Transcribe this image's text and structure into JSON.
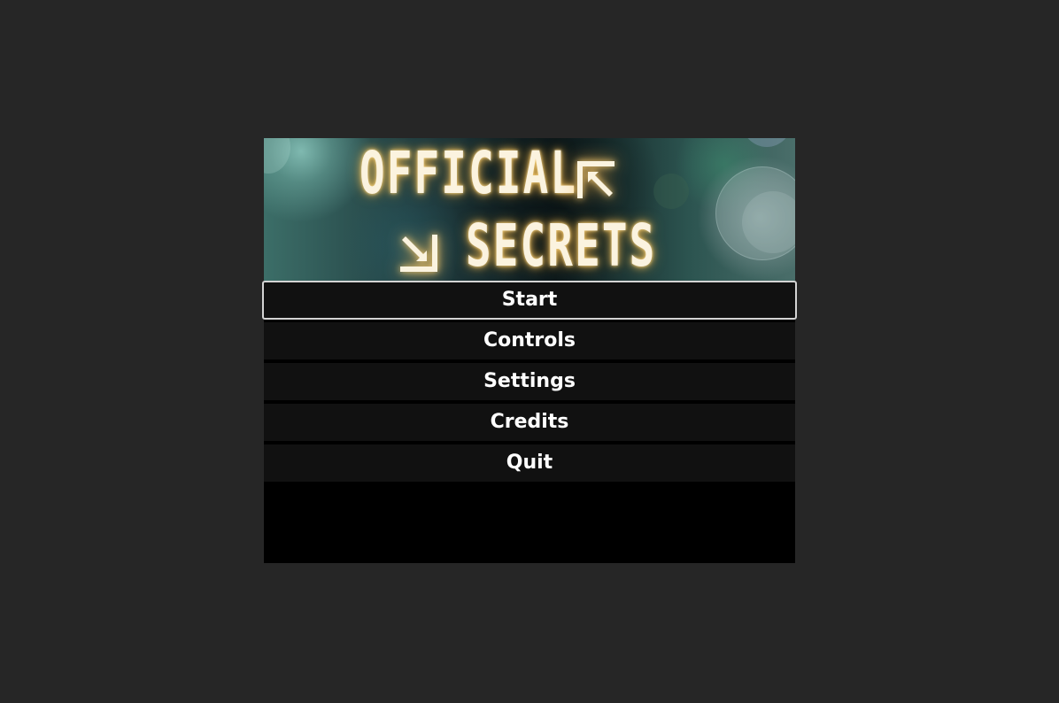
{
  "game": {
    "title_line_1": "OFFICIAL",
    "title_line_2": "SECRETS",
    "icons": [
      "arrow-up-left-icon",
      "arrow-down-right-icon"
    ]
  },
  "menu": {
    "items": [
      {
        "label": "Start",
        "selected": true
      },
      {
        "label": "Controls",
        "selected": false
      },
      {
        "label": "Settings",
        "selected": false
      },
      {
        "label": "Credits",
        "selected": false
      },
      {
        "label": "Quit",
        "selected": false
      }
    ]
  },
  "colors": {
    "page_background": "#262626",
    "frame_background": "#000000",
    "button_background": "#111111",
    "button_text": "#ffffff",
    "selected_border": "#d4d4d4",
    "logo_glow": "#ffc864"
  }
}
